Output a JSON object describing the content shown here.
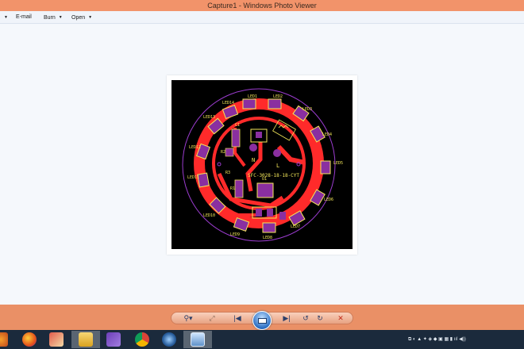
{
  "window": {
    "title": "Capture1 - Windows Photo Viewer"
  },
  "menu": {
    "items": [
      {
        "label": "E-mail"
      },
      {
        "label": "Burn"
      },
      {
        "label": "Open"
      }
    ]
  },
  "pcb": {
    "silkscreen_color": "#f5e85a",
    "copper_color": "#ff2a2a",
    "pad_color": "#8a2fa0",
    "outline_color": "#9b3ccf",
    "labels": {
      "board_id": "SFC-3028-18-18-CYT",
      "n": "N",
      "l": "L",
      "c1": "C1",
      "r1": "R1",
      "r2": "R2",
      "r3": "R3",
      "u1": "U1",
      "led1": "LED1",
      "led2": "LED2",
      "led3": "LED3",
      "led4": "LED4",
      "led5": "LED5",
      "led6": "LED6",
      "led7": "LED7",
      "led8": "LED8",
      "led9": "LED9",
      "led10": "LED10",
      "led11": "LED11",
      "led12": "LED12",
      "led13": "LED13",
      "led14": "LED14",
      "led15": "LED15",
      "led16": "LED16"
    }
  },
  "controls": {
    "zoom_icon": "magnifier-icon",
    "actual_size_icon": "actual-size-icon",
    "previous_icon": "previous-icon",
    "slideshow_icon": "slideshow-icon",
    "next_icon": "next-icon",
    "rotate_ccw_icon": "rotate-counterclockwise-icon",
    "rotate_cw_icon": "rotate-clockwise-icon",
    "delete_icon": "delete-icon"
  },
  "taskbar": {
    "icons": [
      "firefox-icon",
      "paint-icon",
      "file-explorer-icon",
      "visual-studio-icon",
      "chrome-icon",
      "app-icon",
      "photo-viewer-icon"
    ]
  },
  "colors": {
    "title_bar": "#f2936a",
    "control_bar": "#ea9066",
    "taskbar": "#1b2a3c"
  }
}
